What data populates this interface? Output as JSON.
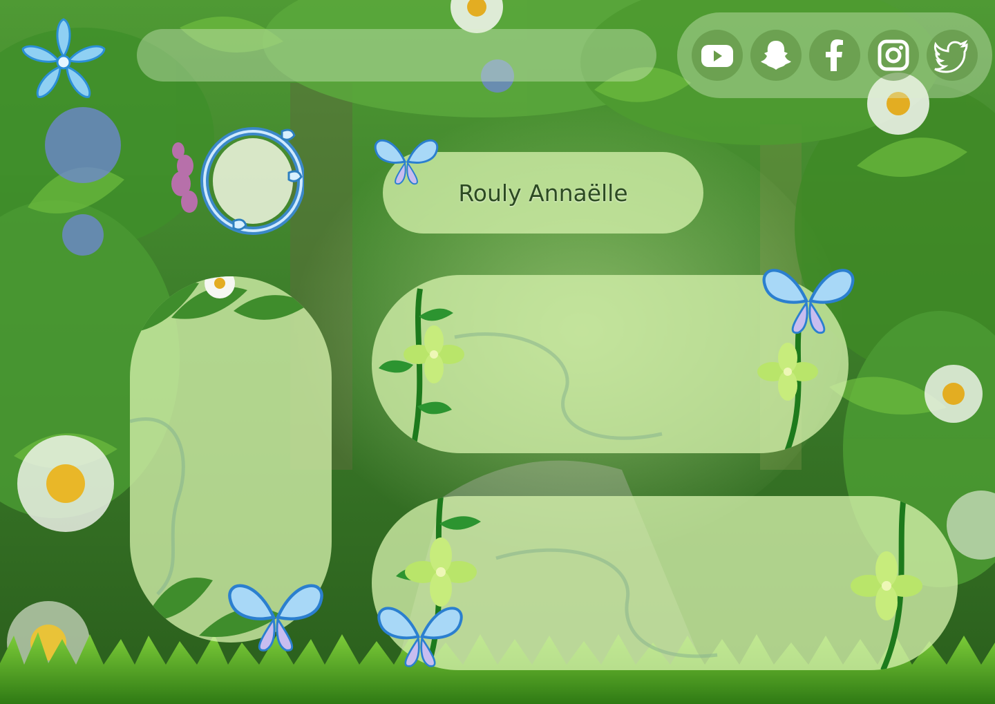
{
  "profile": {
    "name": "Rouly Annaëlle"
  },
  "search": {
    "placeholder": "",
    "value": ""
  },
  "social": [
    {
      "name": "youtube-icon"
    },
    {
      "name": "snapchat-icon"
    },
    {
      "name": "facebook-icon"
    },
    {
      "name": "instagram-icon"
    },
    {
      "name": "twitter-icon"
    }
  ],
  "colors": {
    "accent": "#a9d96a",
    "panel": "#d4f0aa",
    "butterfly": "#6fb8ec",
    "social_bg": "#5a8c3c"
  }
}
